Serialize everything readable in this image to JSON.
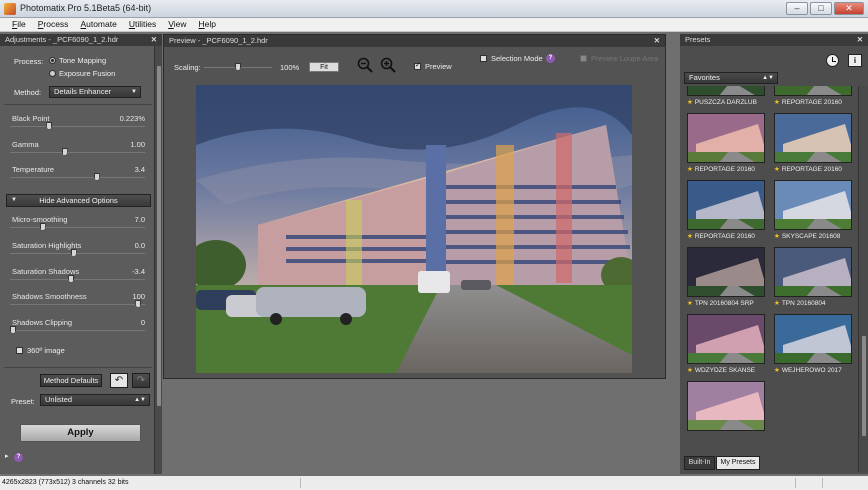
{
  "window": {
    "title": "Photomatix Pro 5.1Beta5 (64-bit)",
    "min": "–",
    "max": "□",
    "close": "✕"
  },
  "menu": [
    {
      "u": "F",
      "rest": "ile"
    },
    {
      "u": "P",
      "rest": "rocess"
    },
    {
      "u": "A",
      "rest": "utomate"
    },
    {
      "u": "U",
      "rest": "tilities"
    },
    {
      "u": "V",
      "rest": "iew"
    },
    {
      "u": "H",
      "rest": "elp"
    }
  ],
  "adjustments": {
    "header": "Adjustments - _PCF6090_1_2.hdr",
    "close": "✕",
    "process_label": "Process:",
    "process_options": [
      "Tone Mapping",
      "Exposure Fusion"
    ],
    "method_label": "Method:",
    "method_value": "Details Enhancer",
    "sliders": [
      {
        "name": "Black Point",
        "value": "0.223%",
        "pos": 0.28
      },
      {
        "name": "Gamma",
        "value": "1.00",
        "pos": 0.4
      },
      {
        "name": "Temperature",
        "value": "3.4",
        "pos": 0.65
      }
    ],
    "advanced_label": "Hide Advanced Options",
    "advanced_sliders": [
      {
        "name": "Micro-smoothing",
        "value": "7.0",
        "pos": 0.23
      },
      {
        "name": "Saturation Highlights",
        "value": "0.0",
        "pos": 0.47
      },
      {
        "name": "Saturation Shadows",
        "value": "-3.4",
        "pos": 0.45
      },
      {
        "name": "Shadows Smoothness",
        "value": "100",
        "pos": 0.97
      },
      {
        "name": "Shadows Clipping",
        "value": "0",
        "pos": 0.0
      }
    ],
    "image360_label": "360º image",
    "method_defaults": "Method Defaults",
    "preset_label": "Preset:",
    "preset_value": "Unlisted",
    "apply": "Apply"
  },
  "preview": {
    "header": "Preview - _PCF6090_1_2.hdr",
    "close": "✕",
    "scaling_label": "Scaling:",
    "scaling_value": "100%",
    "fit": "Fit",
    "preview_label": "Preview",
    "selection_mode": "Selection Mode",
    "right_option": "Preview Loupe Area"
  },
  "presets": {
    "header": "Presets",
    "close": "✕",
    "category": "Favorites",
    "items": [
      {
        "label": "PUSZCZA DARZLUB",
        "style": "a"
      },
      {
        "label": "REPORTAGE 20160",
        "style": "b"
      },
      {
        "label": "REPORTAGE 20160",
        "style": "c"
      },
      {
        "label": "REPORTAGE 20160",
        "style": "d"
      },
      {
        "label": "REPORTAGE 20160",
        "style": "e"
      },
      {
        "label": "SKYSCAPE 201608",
        "style": "f"
      },
      {
        "label": "TPN 20160804 SRP",
        "style": "g"
      },
      {
        "label": "TPN 20160804",
        "style": "h"
      },
      {
        "label": "WDZYDZE SKANSE",
        "style": "i"
      },
      {
        "label": "WEJHEROWO 2017",
        "style": "j"
      },
      {
        "label": "",
        "style": "k"
      }
    ],
    "tabs": [
      "Built-In",
      "My Presets"
    ]
  },
  "status": {
    "text": "4265x2823 (773x512) 3 channels 32 bits"
  },
  "colors": {
    "panel": "#5c5c5c",
    "header": "#3a3a3a",
    "accent_purple": "#8c5ab0",
    "star": "#f2c21c"
  }
}
